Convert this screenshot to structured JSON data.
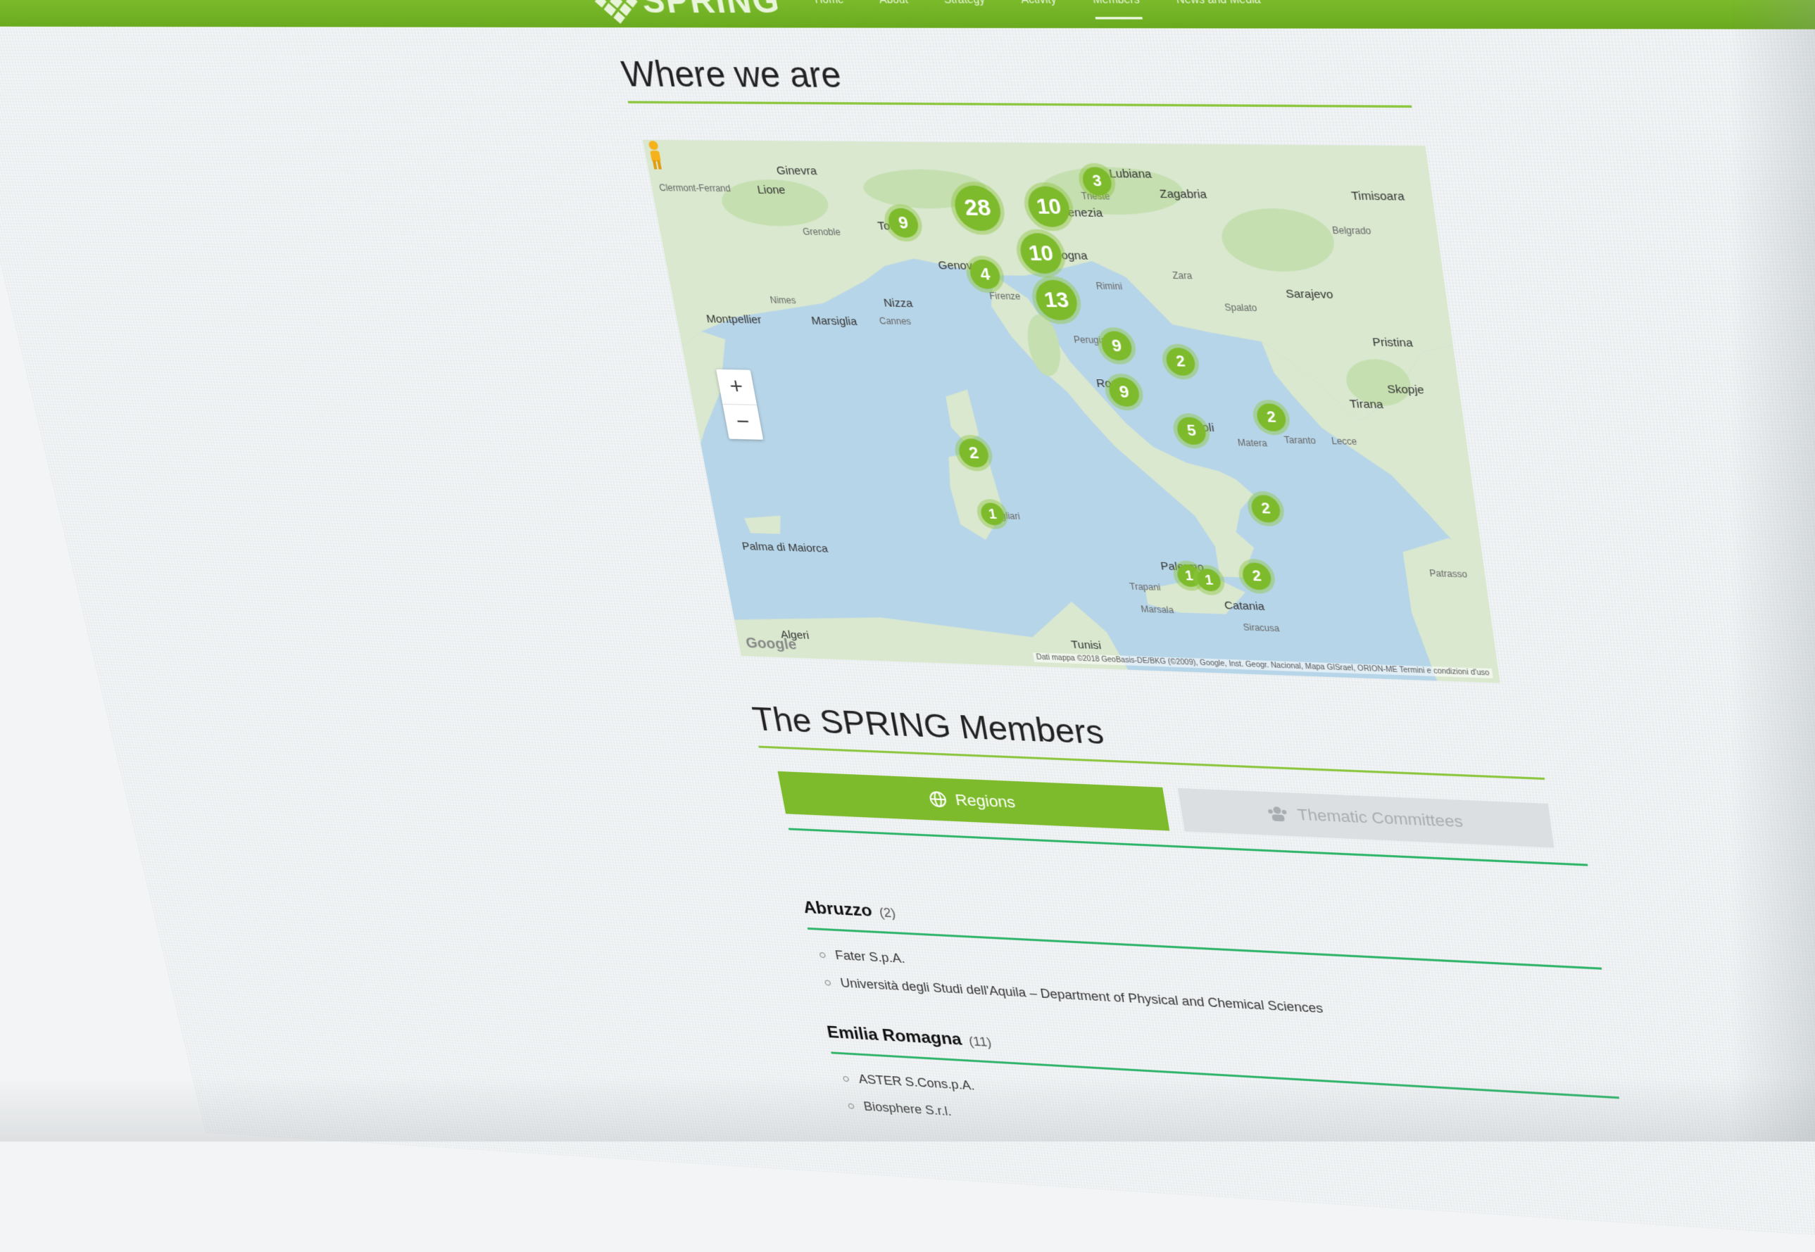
{
  "site": {
    "logo_text": "SPRING"
  },
  "nav": {
    "items": [
      "Home",
      "About",
      "Strategy",
      "Activity",
      "Members",
      "News and Media"
    ],
    "active": "Members"
  },
  "where": {
    "title": "Where we are"
  },
  "map": {
    "cities": [
      "Ginevra",
      "Lione",
      "Clermont-Ferrand",
      "Grenoble",
      "Torino",
      "Genova",
      "Nizza",
      "Cannes",
      "Marsiglia",
      "Nimes",
      "Montpellier",
      "Venezia",
      "Bologna",
      "Firenze",
      "Perugia",
      "Roma",
      "Rimini",
      "Lubiana",
      "Zagabria",
      "Trieste",
      "Zara",
      "Spalato",
      "Sarajevo",
      "Belgrado",
      "Timisoara",
      "Pristina",
      "Skopje",
      "Tirana",
      "Napoli",
      "Matera",
      "Taranto",
      "Lecce",
      "Palermo",
      "Trapani",
      "Marsala",
      "Catania",
      "Siracusa",
      "Cagliari",
      "Palma di Maiorca",
      "Tunisi",
      "Algeri",
      "Patrasso"
    ],
    "clusters": [
      28,
      10,
      10,
      13,
      9,
      4,
      3,
      9,
      9,
      2,
      5,
      2,
      2,
      2,
      1,
      1,
      1,
      2
    ],
    "zoom_in": "+",
    "zoom_out": "−",
    "google": "Google",
    "attribution": "Dati mappa ©2018 GeoBasis-DE/BKG (©2009), Google, Inst. Geogr. Nacional, Mapa GISrael, ORION-ME   Termini e condizioni d'uso"
  },
  "members": {
    "title": "The SPRING Members",
    "tabs": {
      "regions": "Regions",
      "thematic": "Thematic Committees"
    },
    "regions": [
      {
        "name": "Abruzzo",
        "count": "(2)",
        "items": [
          "Fater S.p.A.",
          "Università degli Studi dell'Aquila – Department of Physical and Chemical Sciences"
        ]
      },
      {
        "name": "Emilia Romagna",
        "count": "(11)",
        "items": [
          "ASTER S.Cons.p.A.",
          "Biosphere S.r.l."
        ]
      }
    ]
  },
  "colors": {
    "brand_green": "#7dbb2c",
    "region_rule": "#2fb56a",
    "tab_inactive": "#dcdfe1"
  }
}
